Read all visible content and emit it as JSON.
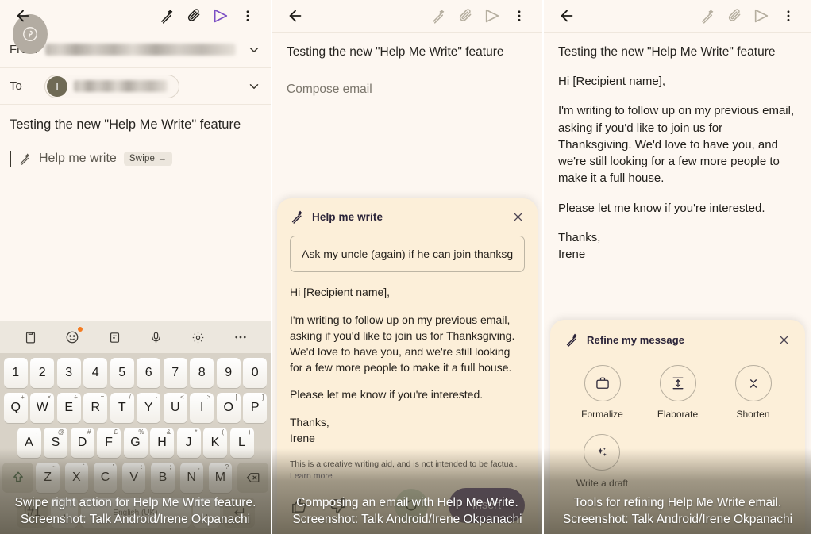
{
  "panel1": {
    "appbar": {
      "back_icon": "back-arrow-icon",
      "magic_pen_icon": "magic-pen-icon",
      "attach_icon": "paperclip-icon",
      "send_icon": "send-icon",
      "more_icon": "more-vertical-icon"
    },
    "avatar_badge": "pinterest-icon",
    "from_label": "From",
    "to_label": "To",
    "to_chip_initial": "I",
    "subject": "Testing the new \"Help Me Write\" feature",
    "help_me_write_label": "Help me write",
    "swipe_chip": "Swipe →",
    "keyboard": {
      "toolbar_icons": [
        "clipboard-icon",
        "emoji-icon",
        "sticker-icon",
        "microphone-icon",
        "settings-icon",
        "overflow-icon"
      ],
      "row_numbers": [
        "1",
        "2",
        "3",
        "4",
        "5",
        "6",
        "7",
        "8",
        "9",
        "0"
      ],
      "row_q": [
        {
          "key": "Q",
          "sup": "+"
        },
        {
          "key": "W",
          "sup": "×"
        },
        {
          "key": "E",
          "sup": "÷"
        },
        {
          "key": "R",
          "sup": "="
        },
        {
          "key": "T",
          "sup": "/"
        },
        {
          "key": "Y",
          "sup": "-"
        },
        {
          "key": "U",
          "sup": "<"
        },
        {
          "key": "I",
          "sup": ">"
        },
        {
          "key": "O",
          "sup": "["
        },
        {
          "key": "P",
          "sup": "]"
        }
      ],
      "row_a": [
        {
          "key": "A",
          "sup": "!"
        },
        {
          "key": "S",
          "sup": "@"
        },
        {
          "key": "D",
          "sup": "#"
        },
        {
          "key": "F",
          "sup": "£"
        },
        {
          "key": "G",
          "sup": "%"
        },
        {
          "key": "H",
          "sup": "&"
        },
        {
          "key": "J",
          "sup": "*"
        },
        {
          "key": "K",
          "sup": "("
        },
        {
          "key": "L",
          "sup": ")"
        }
      ],
      "row_z": [
        {
          "key": "Z",
          "sup": "~"
        },
        {
          "key": "X",
          "sup": "`"
        },
        {
          "key": "C",
          "sup": "'"
        },
        {
          "key": "V",
          "sup": ":"
        },
        {
          "key": "B",
          "sup": ";"
        },
        {
          "key": "N",
          "sup": ","
        },
        {
          "key": "M",
          "sup": "?"
        }
      ],
      "shift_key": "shift-icon",
      "backspace_key": "backspace-icon",
      "symbols_key": "!#1",
      "comma_key": ",",
      "space_key": "English (UK)",
      "period_key": ".",
      "enter_key": "enter-icon"
    },
    "caption": "Swipe right action for Help Me Write feature. Screenshot: Talk Android/Irene Okpanachi"
  },
  "panel2": {
    "subject": "Testing the new \"Help Me Write\" feature",
    "compose_placeholder": "Compose email",
    "card": {
      "title": "Help me write",
      "close_icon": "close-icon",
      "magic_pen_icon": "magic-pen-icon",
      "prompt_value": "Ask my uncle (again) if he can join thanksg",
      "draft_paragraphs": [
        "Hi [Recipient name],",
        "I'm writing to follow up on my previous email, asking if you'd like to join us for Thanksgiving. We'd love to have you, and we're still looking for a few more people to make it a full house.",
        "Please let me know if you're interested.",
        "Thanks,\nIrene"
      ],
      "disclaimer": "This is a creative writing aid, and is not intended to be factual.",
      "learn_more": "Learn more",
      "thumbs_up_icon": "thumb-up-icon",
      "thumbs_down_icon": "thumb-down-icon",
      "refresh_icon": "refresh-icon",
      "insert_label": "Insert"
    },
    "caption": "Composing an email with Help Me Write. Screenshot: Talk Android/Irene Okpanachi"
  },
  "panel3": {
    "subject": "Testing the new \"Help Me Write\" feature",
    "body_paragraphs": [
      "Hi [Recipient name],",
      "I'm writing to follow up on my previous email, asking if you'd like to join us for Thanksgiving. We'd love to have you, and we're still looking for a few more people to make it a full house.",
      "Please let me know if you're interested.",
      "Thanks,\nIrene"
    ],
    "card": {
      "title": "Refine my message",
      "close_icon": "close-icon",
      "magic_pen_icon": "magic-pen-icon",
      "tools": [
        {
          "label": "Formalize",
          "icon": "briefcase-icon"
        },
        {
          "label": "Elaborate",
          "icon": "expand-vertical-icon"
        },
        {
          "label": "Shorten",
          "icon": "collapse-vertical-icon"
        },
        {
          "label": "Write a draft",
          "icon": "sparkle-icon"
        }
      ]
    },
    "caption": "Tools for refining Help Me Write email. Screenshot: Talk Android/Irene Okpanachi"
  },
  "colors": {
    "page_bg": "#fdf7f1",
    "card_bg": "#fcefd9",
    "accent_purple": "#4e3a66",
    "keyboard_bg": "#d8d2c7",
    "refresh_green": "#cfd6b9"
  }
}
